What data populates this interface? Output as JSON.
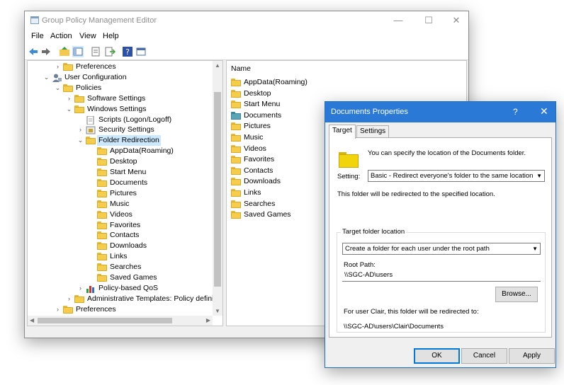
{
  "window": {
    "title": "Group Policy Management Editor",
    "controls": {
      "minimize": "—",
      "maximize": "☐",
      "close": "✕"
    }
  },
  "menu": [
    "File",
    "Action",
    "View",
    "Help"
  ],
  "toolbar_icons": [
    "back-icon",
    "forward-icon",
    "up-folder-icon",
    "show-tree-icon",
    "properties-icon",
    "export-icon",
    "help-icon",
    "view-icon"
  ],
  "tree": [
    {
      "label": "Preferences",
      "expander": "›"
    },
    {
      "label": "User Configuration",
      "expander": "⌄"
    },
    {
      "label": "Policies",
      "expander": "⌄"
    },
    {
      "label": "Software Settings",
      "expander": "›"
    },
    {
      "label": "Windows Settings",
      "expander": "⌄"
    },
    {
      "label": "Scripts (Logon/Logoff)",
      "expander": ""
    },
    {
      "label": "Security Settings",
      "expander": "›"
    },
    {
      "label": "Folder Redirection",
      "expander": "⌄"
    },
    {
      "label": "AppData(Roaming)",
      "expander": ""
    },
    {
      "label": "Desktop",
      "expander": ""
    },
    {
      "label": "Start Menu",
      "expander": ""
    },
    {
      "label": "Documents",
      "expander": ""
    },
    {
      "label": "Pictures",
      "expander": ""
    },
    {
      "label": "Music",
      "expander": ""
    },
    {
      "label": "Videos",
      "expander": ""
    },
    {
      "label": "Favorites",
      "expander": ""
    },
    {
      "label": "Contacts",
      "expander": ""
    },
    {
      "label": "Downloads",
      "expander": ""
    },
    {
      "label": "Links",
      "expander": ""
    },
    {
      "label": "Searches",
      "expander": ""
    },
    {
      "label": "Saved Games",
      "expander": ""
    },
    {
      "label": "Policy-based QoS",
      "expander": "›"
    },
    {
      "label": "Administrative Templates: Policy definitions (AI",
      "expander": "›"
    },
    {
      "label": "Preferences",
      "expander": "›"
    }
  ],
  "list": {
    "header": "Name",
    "items": [
      "AppData(Roaming)",
      "Desktop",
      "Start Menu",
      "Documents",
      "Pictures",
      "Music",
      "Videos",
      "Favorites",
      "Contacts",
      "Downloads",
      "Links",
      "Searches",
      "Saved Games"
    ]
  },
  "dialog": {
    "title": "Documents Properties",
    "help": "?",
    "close": "✕",
    "tabs": [
      "Target",
      "Settings"
    ],
    "intro": "You can specify the location of the Documents folder.",
    "setting_label": "Setting:",
    "setting_value": "Basic - Redirect everyone's folder to the same location",
    "redirect_note": "This folder will be redirected to the specified location.",
    "group_title": "Target folder location",
    "location_value": "Create a folder for each user under the root path",
    "root_path_label": "Root Path:",
    "root_path_value": "\\\\SGC-AD\\users",
    "browse": "Browse...",
    "user_note": "For user Clair, this folder will be redirected to:",
    "user_path": "\\\\SGC-AD\\users\\Clair\\Documents",
    "ok": "OK",
    "cancel": "Cancel",
    "apply": "Apply"
  },
  "colors": {
    "accent": "#2b79d6",
    "selection": "#cce8ff",
    "folder": "#f5cd4b"
  }
}
